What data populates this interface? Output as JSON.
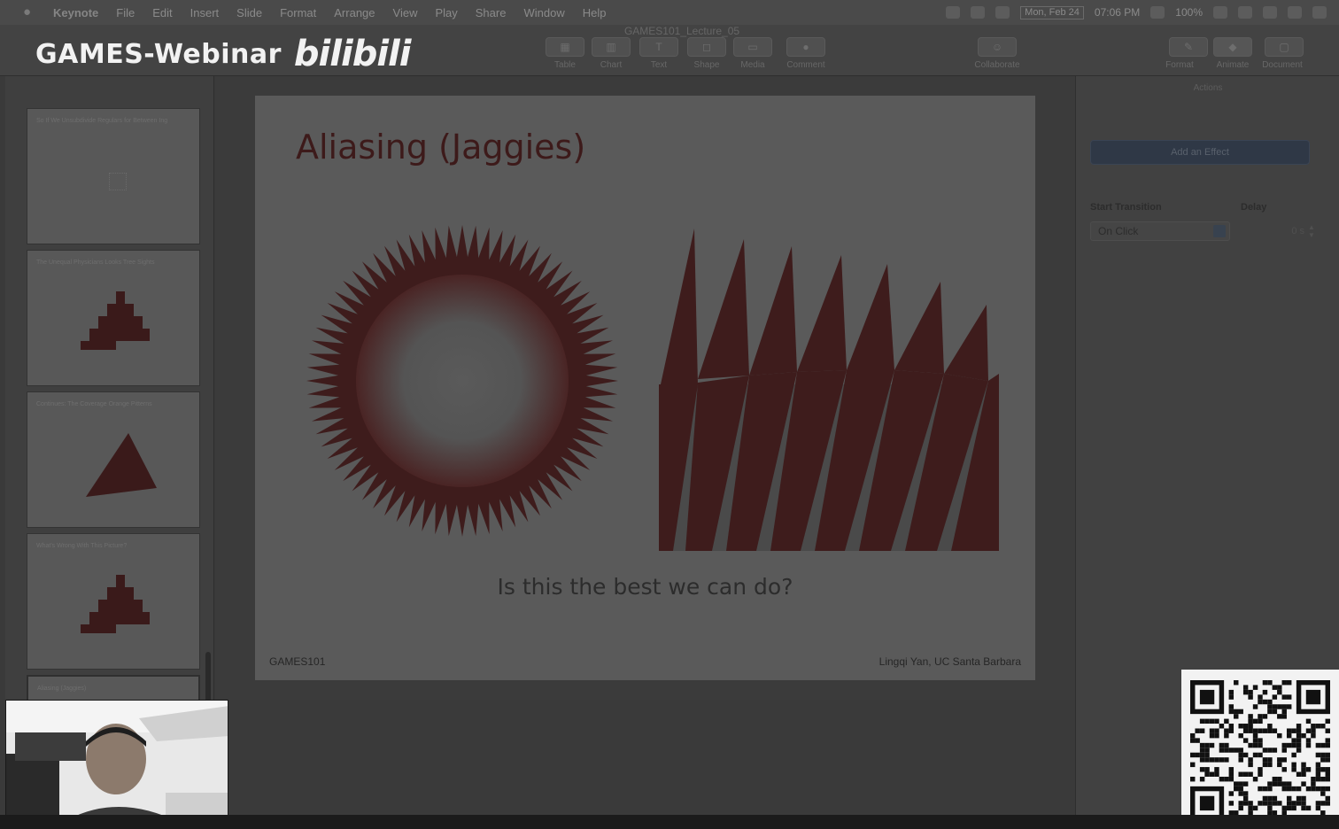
{
  "menubar": {
    "app_name": "Keynote",
    "items": [
      "File",
      "Edit",
      "Insert",
      "Slide",
      "Format",
      "Arrange",
      "View",
      "Play",
      "Share",
      "Window",
      "Help"
    ],
    "date": "Mon, Feb 24",
    "time": "07:06 PM",
    "battery": "100%"
  },
  "toolbar": {
    "doc_title": "GAMES101_Lecture_05",
    "buttons": [
      {
        "label": "Table",
        "glyph": "▦"
      },
      {
        "label": "Chart",
        "glyph": "▥"
      },
      {
        "label": "Text",
        "glyph": "T"
      },
      {
        "label": "Shape",
        "glyph": "◻"
      },
      {
        "label": "Media",
        "glyph": "▭"
      },
      {
        "label": "Comment",
        "glyph": "●"
      },
      {
        "label": "Collaborate",
        "glyph": "☺"
      },
      {
        "label": "Format",
        "glyph": "✎"
      },
      {
        "label": "Animate",
        "glyph": "◆"
      },
      {
        "label": "Document",
        "glyph": "▢"
      }
    ]
  },
  "watermark": {
    "text": "GAMES-Webinar",
    "logo": "bilibili"
  },
  "navigator": {
    "slides": [
      {
        "title": "So If We Unsubdivide Regulars for Between Ing"
      },
      {
        "title": "The Unequal Physicians Looks Tree Sights"
      },
      {
        "title": "Continues: The Coverage Orange Pitterns"
      },
      {
        "title": "What's Wrong With This Picture?"
      },
      {
        "title": "Aliasing (Jaggies)"
      }
    ]
  },
  "slide": {
    "title": "Aliasing (Jaggies)",
    "question": "Is this the best we can do?",
    "footer_left": "GAMES101",
    "footer_right": "Lingqi Yan, UC Santa Barbara"
  },
  "inspector": {
    "tabs": "Actions",
    "add_effect": "Add an Effect",
    "start_transition_label": "Start Transition",
    "delay_label": "Delay",
    "start_value": "On Click",
    "delay_value": "0 s"
  },
  "colors": {
    "slide_bg": "#5a5a5a",
    "accent_red": "#3d1a1a",
    "qr_bg": "#f2f2f2"
  }
}
